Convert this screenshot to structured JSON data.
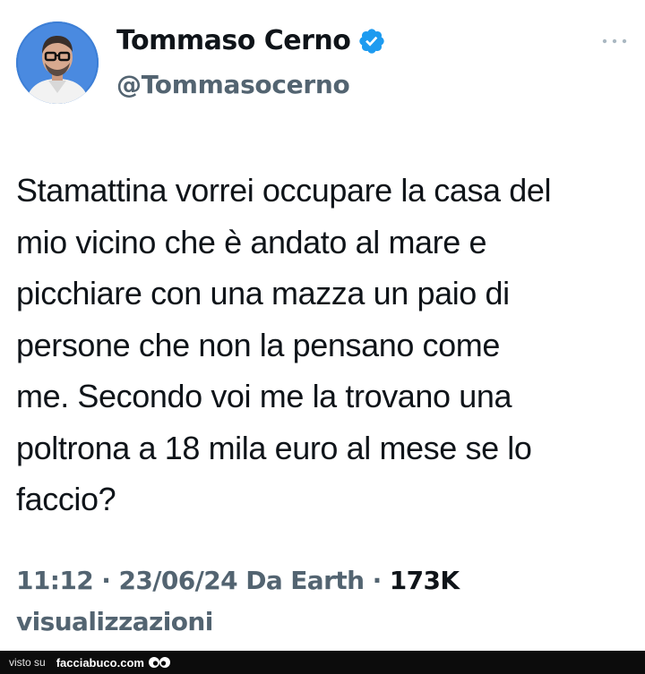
{
  "author": {
    "display_name": "Tommaso Cerno",
    "handle": "@Tommasocerno",
    "verified_icon": "verified-badge-icon",
    "avatar": "profile-photo"
  },
  "more_icon": "more-horizontal-icon",
  "tweet": {
    "text": "Stamattina vorrei occupare la casa del\nmio vicino che è andato al mare e\npicchiare con una mazza un paio di\npersone che non la pensano come\nme. Secondo voi me la trovano una\npoltrona a 18 mila euro al mese se lo\nfaccio?"
  },
  "meta": {
    "time": "11:12",
    "sep1": " · ",
    "date": "23/06/24",
    "source": " Da Earth",
    "sep2": " · ",
    "views_count": "173K",
    "views_label": "visualizzazioni"
  },
  "watermark": {
    "prefix": "visto su",
    "site": "facciabuco.com"
  },
  "colors": {
    "accent": "#1d9bf0",
    "text": "#0f1419",
    "secondary": "#536471",
    "footer_bg": "#0c0c0c"
  }
}
